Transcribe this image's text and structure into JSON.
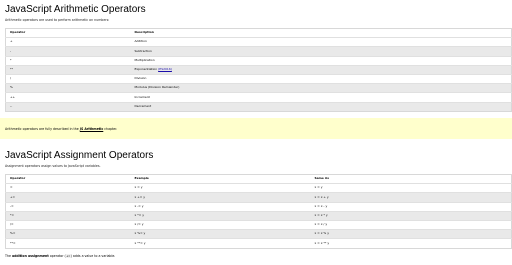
{
  "arith": {
    "title": "JavaScript Arithmetic Operators",
    "intro": "Arithmetic operators are used to perform arithmetic on numbers:",
    "headers": [
      "Operator",
      "Description"
    ],
    "rows": [
      [
        "+",
        "Addition"
      ],
      [
        "-",
        "Subtraction"
      ],
      [
        "*",
        "Multiplication"
      ],
      [
        "**",
        "Exponentiation"
      ],
      [
        "/",
        "Division"
      ],
      [
        "%",
        "Modulus (Division Remainder)"
      ],
      [
        "++",
        "Increment"
      ],
      [
        "--",
        "Decrement"
      ]
    ],
    "es_link": "(ES2016)"
  },
  "note": {
    "prefix": "Arithmetic operators are fully described in the ",
    "link": "JS Arithmetic",
    "suffix": " chapter."
  },
  "assign": {
    "title": "JavaScript Assignment Operators",
    "intro": "Assignment operators assign values to JavaScript variables.",
    "headers": [
      "Operator",
      "Example",
      "Same As"
    ],
    "rows": [
      [
        "=",
        "x = y",
        "x = y"
      ],
      [
        "+=",
        "x += y",
        "x = x + y"
      ],
      [
        "-=",
        "x -= y",
        "x = x - y"
      ],
      [
        "*=",
        "x *= y",
        "x = x * y"
      ],
      [
        "/=",
        "x /= y",
        "x = x / y"
      ],
      [
        "%=",
        "x %= y",
        "x = x % y"
      ],
      [
        "**=",
        "x **= y",
        "x = x ** y"
      ]
    ]
  },
  "footer": {
    "prefix": "The ",
    "bold": "addition assignment",
    "middle": " operator (",
    "code": "+=",
    "suffix": ") adds a value to a variable."
  }
}
